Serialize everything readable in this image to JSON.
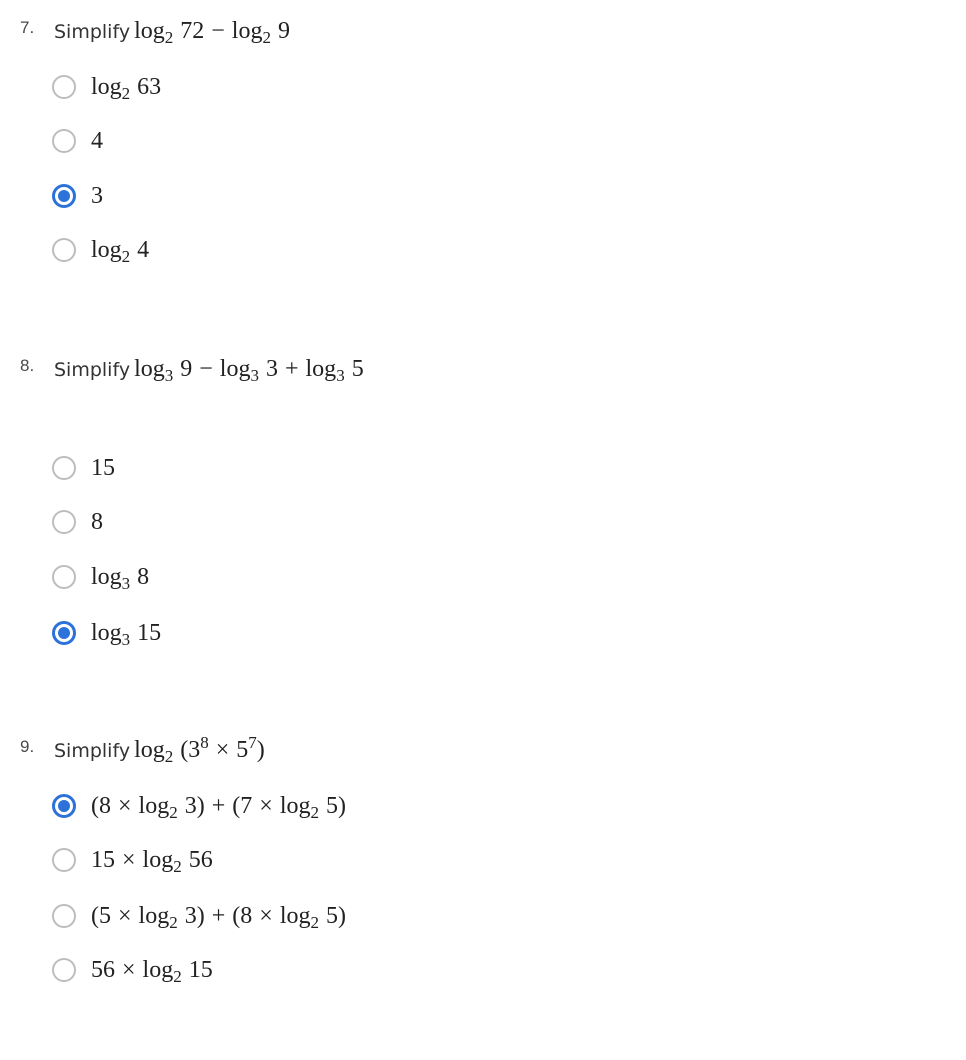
{
  "colors": {
    "selected": "#2d72d9",
    "unselected_border": "#bdbdbd",
    "number_text": "#4a4a4a"
  },
  "questions": [
    {
      "number": "7.",
      "prompt_word": "Simplify",
      "prompt_math": {
        "a_fn": "log",
        "a_base": "2",
        "a_arg": "72",
        "op": "−",
        "b_fn": "log",
        "b_base": "2",
        "b_arg": "9"
      },
      "options": [
        {
          "fn": "log",
          "base": "2",
          "arg": "63",
          "selected": false
        },
        {
          "text": "4",
          "selected": false
        },
        {
          "text": "3",
          "selected": true
        },
        {
          "fn": "log",
          "base": "2",
          "arg": "4",
          "selected": false
        }
      ]
    },
    {
      "number": "8.",
      "prompt_word": "Simplify",
      "prompt_math": {
        "a_fn": "log",
        "a_base": "3",
        "a_arg": "9",
        "op1": "−",
        "b_fn": "log",
        "b_base": "3",
        "b_arg": "3",
        "op2": "+",
        "c_fn": "log",
        "c_base": "3",
        "c_arg": "5"
      },
      "options": [
        {
          "text": "15",
          "selected": false
        },
        {
          "text": "8",
          "selected": false
        },
        {
          "fn": "log",
          "base": "3",
          "arg": "8",
          "selected": false
        },
        {
          "fn": "log",
          "base": "3",
          "arg": "15",
          "selected": true
        }
      ]
    },
    {
      "number": "9.",
      "prompt_word": "Simplify",
      "prompt_math": {
        "fn": "log",
        "base": "2",
        "open": "(",
        "b1": "3",
        "e1": "8",
        "times": "×",
        "b2": "5",
        "e2": "7",
        "close": ")"
      },
      "options": [
        {
          "selected": true,
          "p_open1": "(",
          "c1": "8",
          "x1": "×",
          "fn1": "log",
          "base1": "2",
          "arg1": "3",
          "p_close1": ")",
          "plus": "+",
          "p_open2": "(",
          "c2": "7",
          "x2": "×",
          "fn2": "log",
          "base2": "2",
          "arg2": "5",
          "p_close2": ")"
        },
        {
          "selected": false,
          "c": "15",
          "x": "×",
          "fn": "log",
          "base": "2",
          "arg": "56"
        },
        {
          "selected": false,
          "p_open1": "(",
          "c1": "5",
          "x1": "×",
          "fn1": "log",
          "base1": "2",
          "arg1": "3",
          "p_close1": ")",
          "plus": "+",
          "p_open2": "(",
          "c2": "8",
          "x2": "×",
          "fn2": "log",
          "base2": "2",
          "arg2": "5",
          "p_close2": ")"
        },
        {
          "selected": false,
          "c": "56",
          "x": "×",
          "fn": "log",
          "base": "2",
          "arg": "15"
        }
      ]
    }
  ]
}
